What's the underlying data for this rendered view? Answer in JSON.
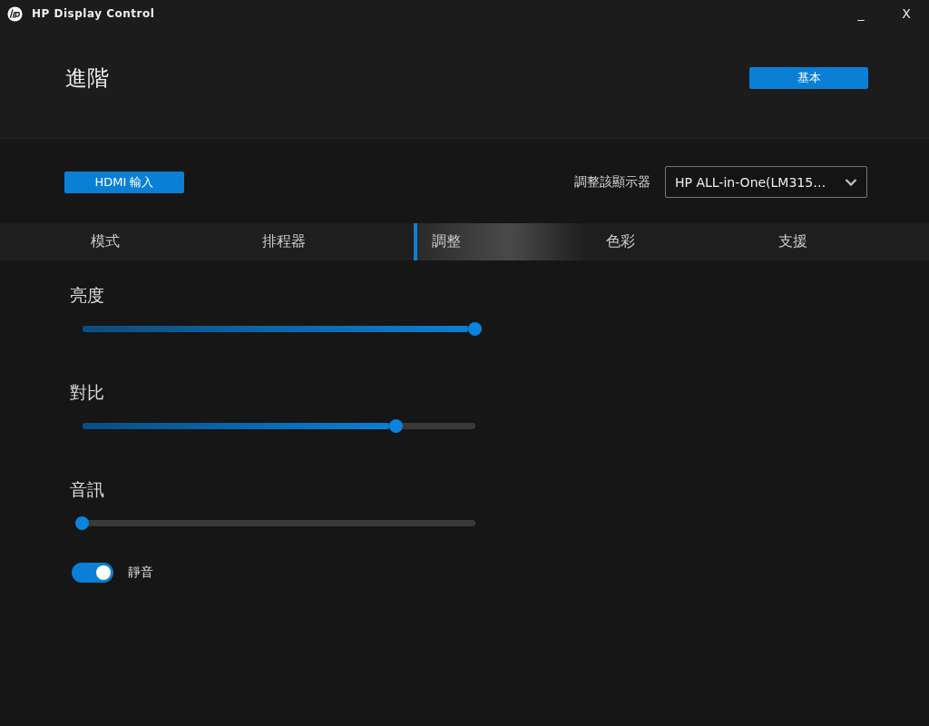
{
  "window": {
    "title": "HP Display Control",
    "controls": [
      "_",
      "X"
    ]
  },
  "header": {
    "title": "進階",
    "mode_button": "基本"
  },
  "input_button": "HDMI 輸入",
  "display_select": {
    "label": "調整該顯示器",
    "value": "HP ALL-in-One(LM315…"
  },
  "tabs": [
    {
      "label": "模式",
      "selected": false
    },
    {
      "label": "排程器",
      "selected": false
    },
    {
      "label": "調整",
      "selected": true
    },
    {
      "label": "色彩",
      "selected": false
    },
    {
      "label": "支援",
      "selected": false
    }
  ],
  "sliders": [
    {
      "label": "亮度",
      "level": 1.0
    },
    {
      "label": "對比",
      "level": 0.8
    },
    {
      "label": "音訊",
      "level": 0.0
    }
  ],
  "mute": {
    "label": "靜音",
    "on": true
  }
}
